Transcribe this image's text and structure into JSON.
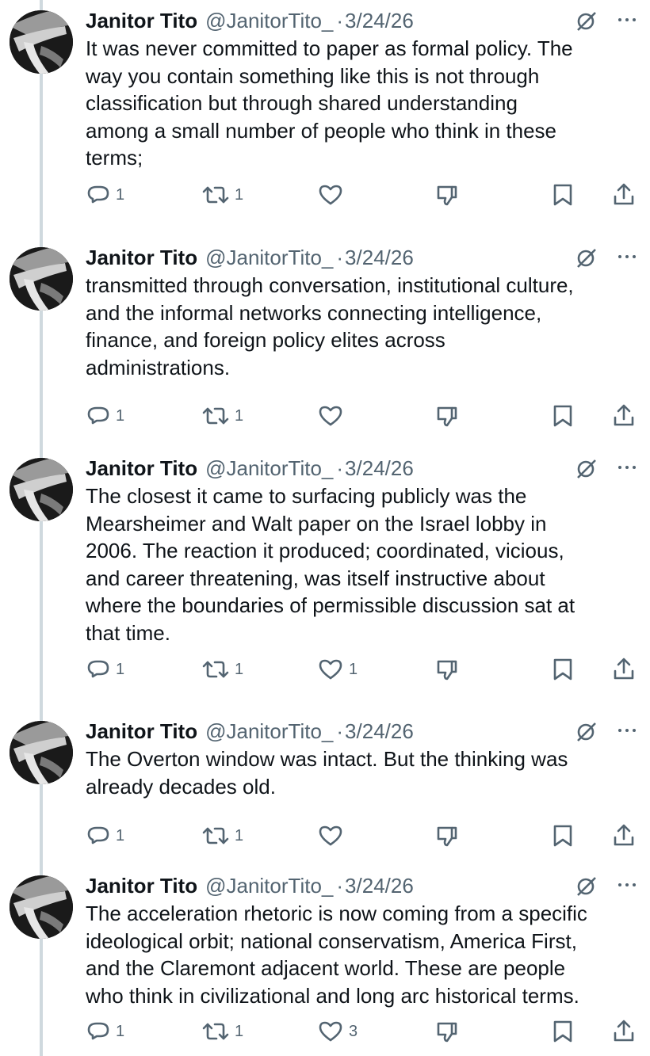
{
  "author": {
    "name": "Janitor Tito",
    "handle": "@JanitorTito_",
    "separator": "·",
    "date": "3/24/26"
  },
  "icons": {
    "avatar": "avatar",
    "grok": "grok-icon",
    "more": "more-icon",
    "reply": "reply-icon",
    "retweet": "retweet-icon",
    "like": "like-icon",
    "tip": "dislike-icon",
    "bookmark": "bookmark-icon",
    "share": "share-icon"
  },
  "colors": {
    "text": "#0f1419",
    "muted": "#536471",
    "thread_line": "#cfd9de"
  },
  "tweets": [
    {
      "lines": [
        "It was never committed to paper as formal policy. The",
        "way you contain something like this is not through",
        "classification but through shared understanding",
        "among a small number of people who think in these",
        "terms;"
      ],
      "replies": "1",
      "retweets": "1",
      "likes": ""
    },
    {
      "lines": [
        "transmitted through conversation, institutional culture,",
        "and the informal networks connecting intelligence,",
        "finance, and foreign policy elites across",
        "administrations."
      ],
      "replies": "1",
      "retweets": "1",
      "likes": ""
    },
    {
      "lines": [
        "The closest it came to surfacing publicly was the",
        "Mearsheimer and Walt paper on the Israel lobby in",
        "2006. The reaction it produced; coordinated, vicious,",
        "and career threatening, was itself instructive about",
        "where the boundaries of permissible discussion sat at",
        "that time."
      ],
      "replies": "1",
      "retweets": "1",
      "likes": "1"
    },
    {
      "lines": [
        "The Overton window was intact. But the thinking was",
        "already decades old."
      ],
      "replies": "1",
      "retweets": "1",
      "likes": ""
    },
    {
      "lines": [
        "The acceleration rhetoric is now coming from a specific",
        "ideological orbit; national conservatism, America First,",
        "and the Claremont adjacent world. These are people",
        "who think in civilizational and long arc historical terms."
      ],
      "replies": "1",
      "retweets": "1",
      "likes": "3"
    }
  ]
}
